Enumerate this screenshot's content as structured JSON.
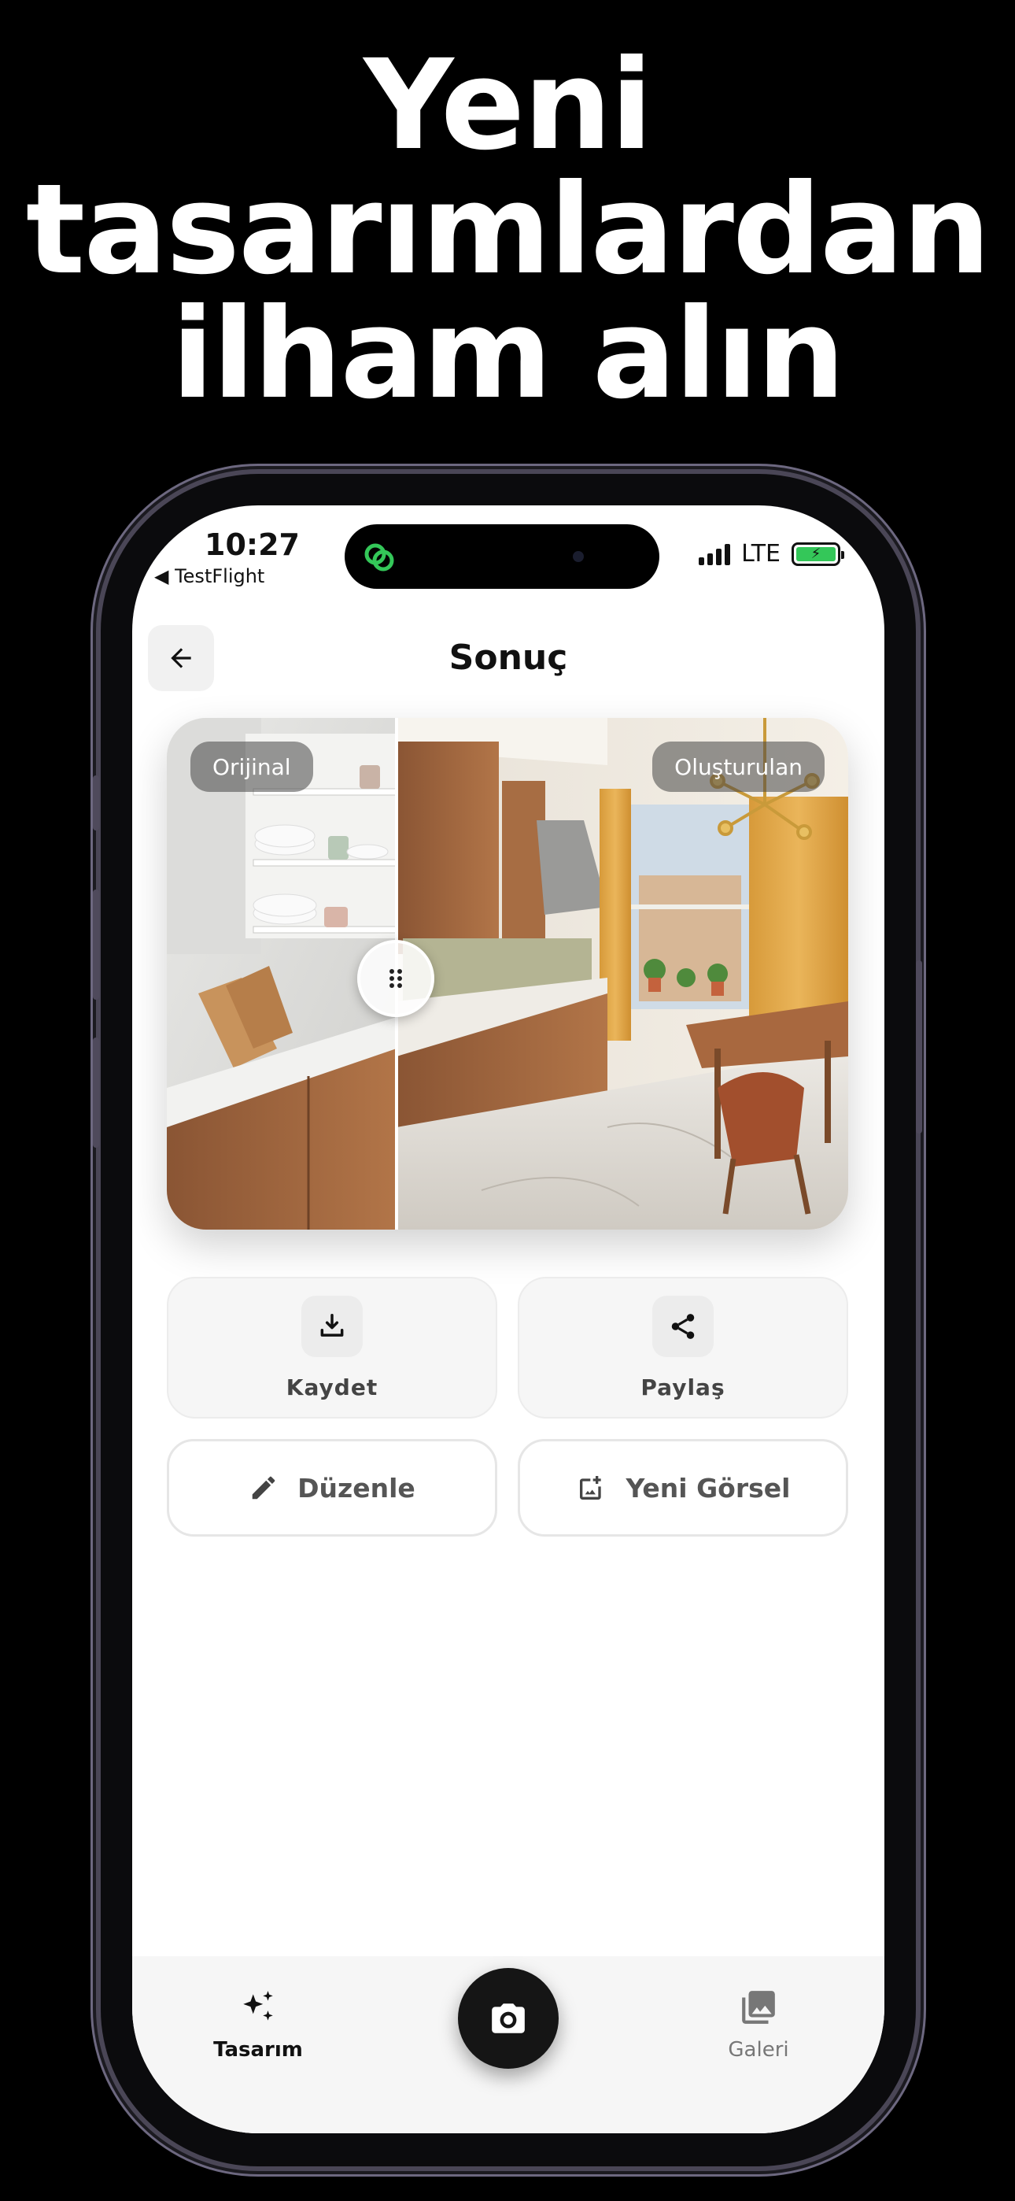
{
  "promo": {
    "line1": "Yeni",
    "line2": "tasarımlardan",
    "line3": "ilham alın"
  },
  "status": {
    "time": "10:27",
    "back_app": "◀ TestFlight",
    "network": "LTE"
  },
  "header": {
    "title": "Sonuç",
    "back_icon": "arrow-left-icon"
  },
  "compare": {
    "original_label": "Orijinal",
    "generated_label": "Oluşturulan",
    "handle_icon": "drag-handle-icon"
  },
  "actions": {
    "save_label": "Kaydet",
    "share_label": "Paylaş",
    "edit_label": "Düzenle",
    "new_image_label": "Yeni Görsel"
  },
  "tabbar": {
    "design_label": "Tasarım",
    "gallery_label": "Galeri",
    "camera_icon": "camera-icon"
  },
  "colors": {
    "accent": "#34c759",
    "fab": "#151515"
  }
}
